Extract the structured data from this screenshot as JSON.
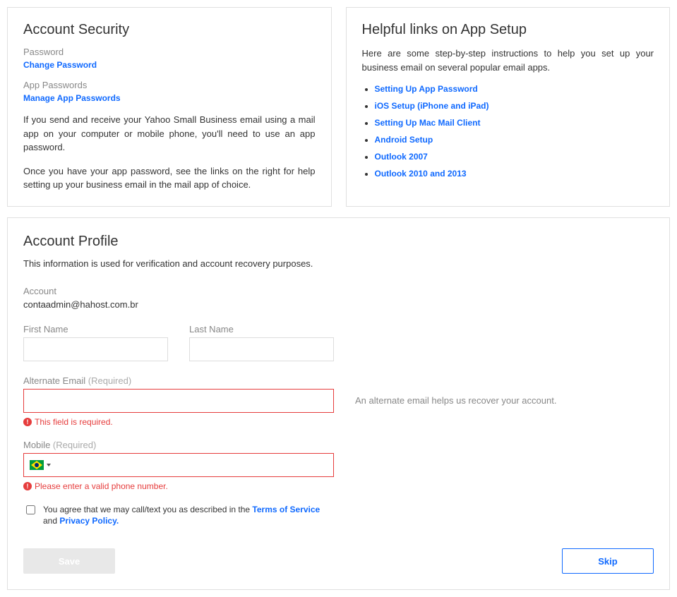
{
  "security": {
    "title": "Account Security",
    "password_label": "Password",
    "change_password": "Change Password",
    "app_passwords_label": "App Passwords",
    "manage_app_passwords": "Manage App Passwords",
    "para1": "If you send and receive your Yahoo Small Business email using a mail app on your computer or mobile phone, you'll need to use an app password.",
    "para2": "Once you have your app password, see the links on the right for help setting up your business email in the mail app of choice."
  },
  "help": {
    "title": "Helpful links on App Setup",
    "intro": "Here are some step-by-step instructions to help you set up your business email on several popular email apps.",
    "links": [
      "Setting Up App Password",
      "iOS Setup (iPhone and iPad)",
      "Setting Up Mac Mail Client",
      "Android Setup",
      "Outlook 2007",
      "Outlook 2010 and 2013"
    ]
  },
  "profile": {
    "title": "Account Profile",
    "desc": "This information is used for verification and account recovery purposes.",
    "account_label": "Account",
    "account_value": "contaadmin@hahost.com.br",
    "first_name_label": "First Name",
    "first_name_value": "",
    "last_name_label": "Last Name",
    "last_name_value": "",
    "alt_email_label": "Alternate Email ",
    "alt_email_required": "(Required)",
    "alt_email_value": "",
    "alt_email_hint": "An alternate email helps us recover your account.",
    "alt_email_error": "This field is required.",
    "mobile_label": "Mobile ",
    "mobile_required": "(Required)",
    "mobile_value": "",
    "mobile_error": "Please enter a valid phone number.",
    "country_selected": "Brazil",
    "consent_prefix": "You agree that we may call/text you as described in the ",
    "consent_tos": "Terms of Service",
    "consent_and": " and ",
    "consent_privacy": "Privacy Policy.",
    "save_label": "Save",
    "skip_label": "Skip"
  }
}
